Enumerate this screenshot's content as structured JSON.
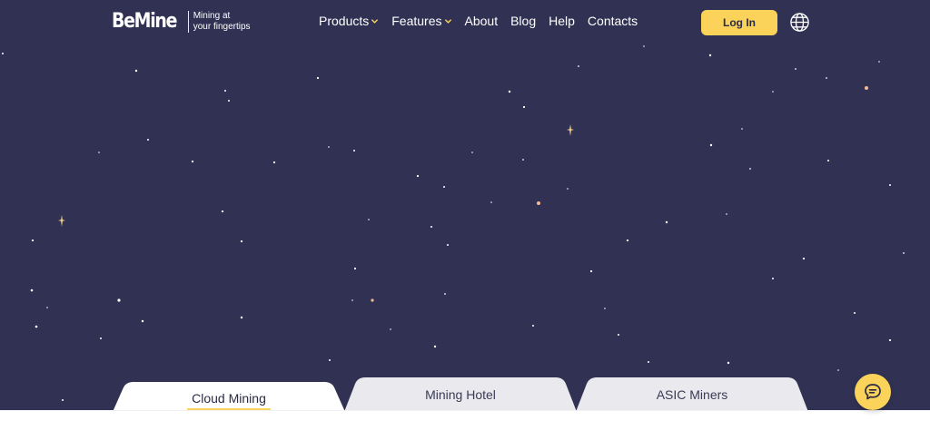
{
  "brand": {
    "name": "BeMine",
    "tagline_line1": "Mining at",
    "tagline_line2": "your fingertips"
  },
  "nav": {
    "items": [
      {
        "label": "Products",
        "has_dropdown": true
      },
      {
        "label": "Features",
        "has_dropdown": true
      },
      {
        "label": "About",
        "has_dropdown": false
      },
      {
        "label": "Blog",
        "has_dropdown": false
      },
      {
        "label": "Help",
        "has_dropdown": false
      },
      {
        "label": "Contacts",
        "has_dropdown": false
      }
    ]
  },
  "header": {
    "login_label": "Log In",
    "language_icon": "globe-icon"
  },
  "tabs": [
    {
      "label": "Cloud Mining",
      "active": true
    },
    {
      "label": "Mining Hotel",
      "active": false
    },
    {
      "label": "ASIC Miners",
      "active": false
    }
  ],
  "chat": {
    "icon": "chat-bubble-icon"
  },
  "colors": {
    "hero_bg": "#313253",
    "accent": "#fbd35b",
    "tab_inactive": "#e9e9ee",
    "text_dark": "#2a2b45",
    "star_warm": "#f6b99a"
  }
}
